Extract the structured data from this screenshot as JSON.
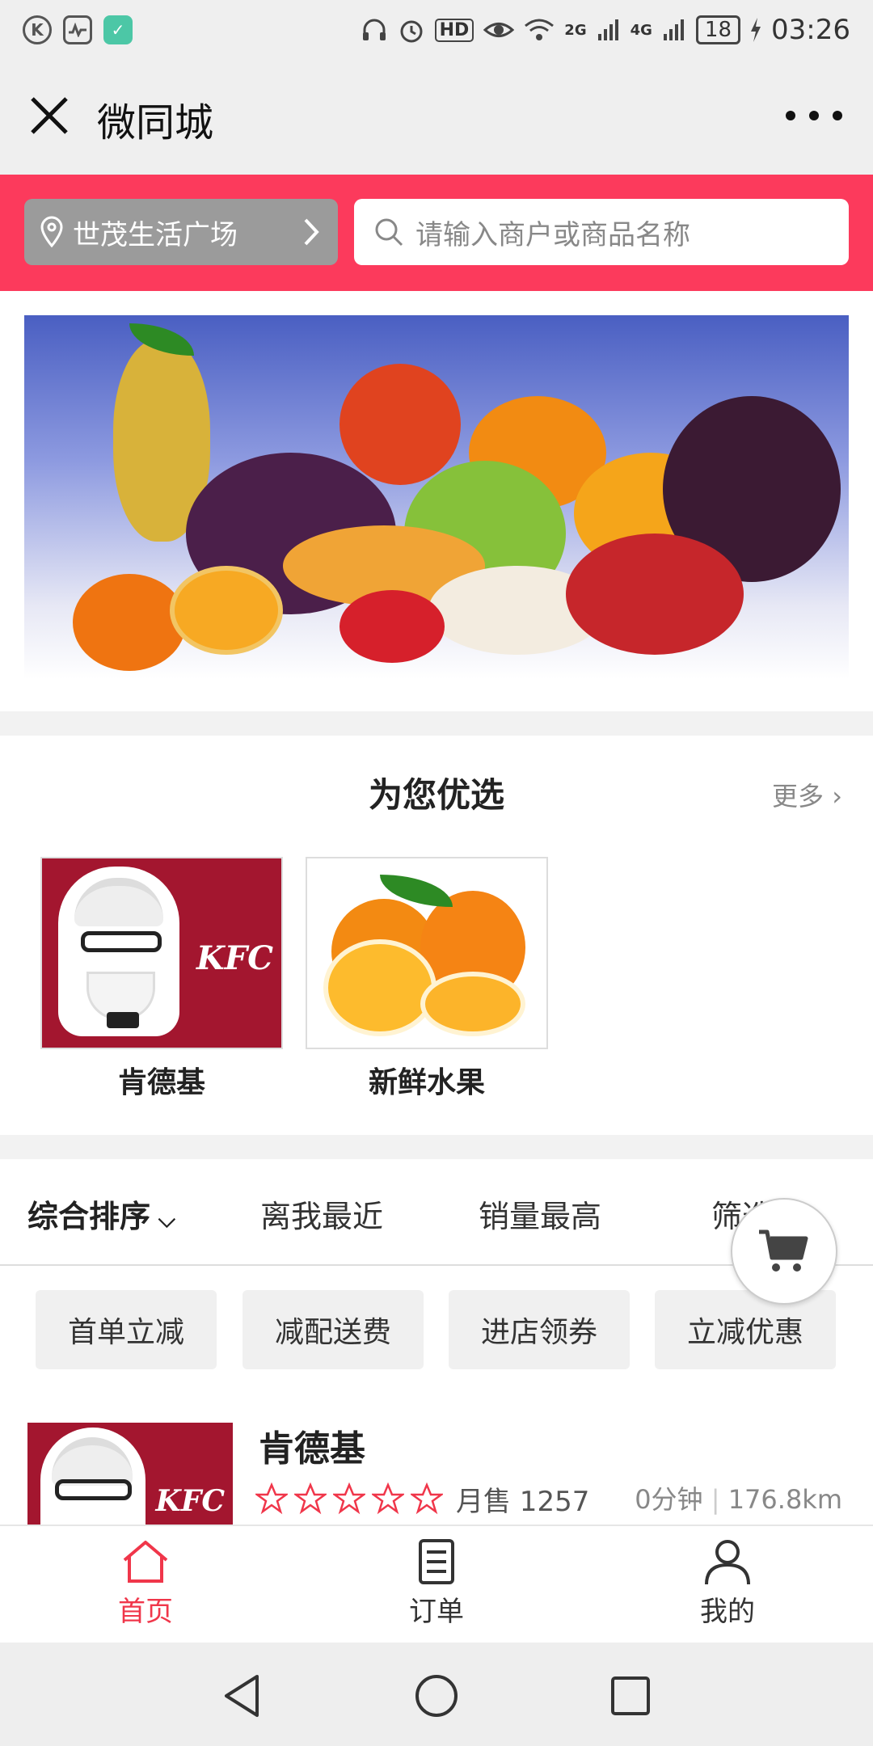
{
  "status_bar": {
    "time": "03:26",
    "hd": "HD",
    "net1": "2G",
    "net2": "4G",
    "battery": "18"
  },
  "header": {
    "title": "微同城"
  },
  "location": {
    "label": "世茂生活广场"
  },
  "search": {
    "placeholder": "请输入商户或商品名称"
  },
  "picks": {
    "title": "为您优选",
    "more": "更多",
    "items": [
      {
        "label": "肯德基",
        "image_text": "KFC"
      },
      {
        "label": "新鲜水果"
      }
    ]
  },
  "sort": {
    "options": [
      "综合排序",
      "离我最近",
      "销量最高",
      "筛选"
    ]
  },
  "tags": [
    "首单立减",
    "减配送费",
    "进店领券",
    "立减优惠"
  ],
  "shop": {
    "name": "肯德基",
    "image_text": "KFC",
    "rating": 0,
    "rating_max": 5,
    "sales": "月售 1257",
    "time": "0分钟",
    "distance": "176.8km"
  },
  "tabs": [
    {
      "label": "首页",
      "icon": "home-icon",
      "active": true
    },
    {
      "label": "订单",
      "icon": "order-icon",
      "active": false
    },
    {
      "label": "我的",
      "icon": "user-icon",
      "active": false
    }
  ],
  "colors": {
    "accent": "#fc3a5c",
    "active_tab": "#f0364a",
    "kfc_red": "#a3162f"
  }
}
